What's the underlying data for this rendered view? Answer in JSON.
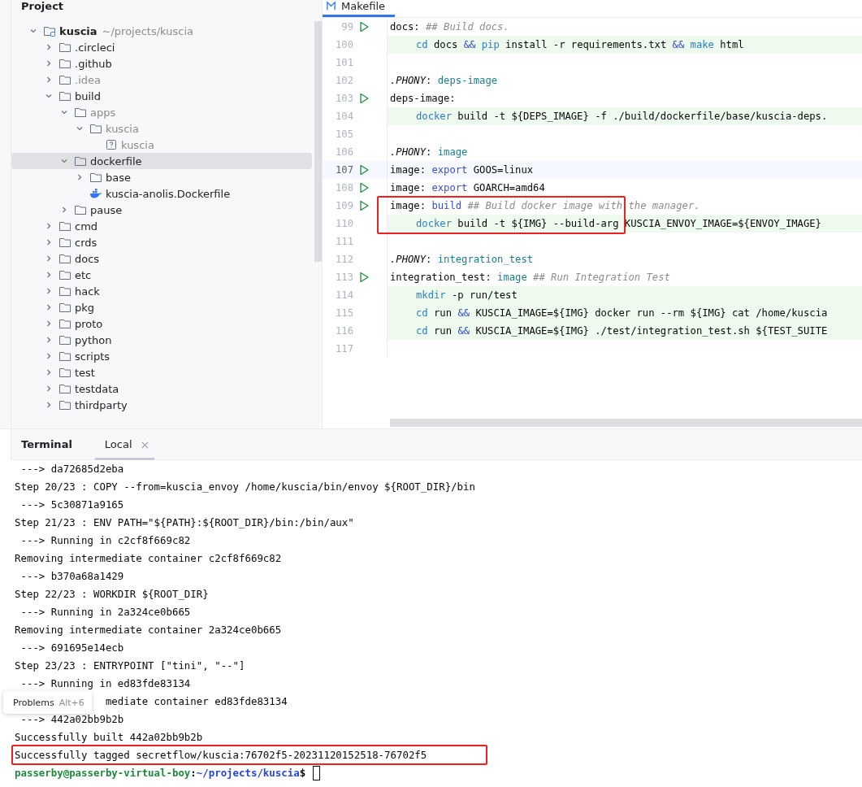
{
  "project_panel": {
    "title": "Project",
    "tree": [
      {
        "name": "kuscia",
        "path": "~/projects/kuscia",
        "kind": "root",
        "expanded": true,
        "excluded": false,
        "selected": false,
        "children": [
          {
            "name": ".circleci",
            "kind": "folder",
            "expanded": false,
            "excluded": false,
            "selected": false
          },
          {
            "name": ".github",
            "kind": "folder",
            "expanded": false,
            "excluded": false,
            "selected": false
          },
          {
            "name": ".idea",
            "kind": "folder",
            "expanded": false,
            "excluded": true,
            "selected": false
          },
          {
            "name": "build",
            "kind": "folder",
            "expanded": true,
            "excluded": false,
            "selected": false,
            "children": [
              {
                "name": "apps",
                "kind": "folder",
                "expanded": true,
                "excluded": true,
                "selected": false,
                "children": [
                  {
                    "name": "kuscia",
                    "kind": "folder",
                    "expanded": true,
                    "excluded": true,
                    "selected": false,
                    "children": [
                      {
                        "name": "kuscia",
                        "kind": "unknown-file",
                        "excluded": true,
                        "selected": false
                      }
                    ]
                  }
                ]
              },
              {
                "name": "dockerfile",
                "kind": "folder",
                "expanded": true,
                "excluded": false,
                "selected": true,
                "children": [
                  {
                    "name": "base",
                    "kind": "folder",
                    "expanded": false,
                    "excluded": false,
                    "selected": false
                  },
                  {
                    "name": "kuscia-anolis.Dockerfile",
                    "kind": "docker-file",
                    "excluded": false,
                    "selected": false
                  }
                ]
              },
              {
                "name": "pause",
                "kind": "folder",
                "expanded": false,
                "excluded": false,
                "selected": false
              }
            ]
          },
          {
            "name": "cmd",
            "kind": "folder",
            "expanded": false,
            "excluded": false,
            "selected": false
          },
          {
            "name": "crds",
            "kind": "folder",
            "expanded": false,
            "excluded": false,
            "selected": false
          },
          {
            "name": "docs",
            "kind": "folder",
            "expanded": false,
            "excluded": false,
            "selected": false
          },
          {
            "name": "etc",
            "kind": "folder",
            "expanded": false,
            "excluded": false,
            "selected": false
          },
          {
            "name": "hack",
            "kind": "folder",
            "expanded": false,
            "excluded": false,
            "selected": false
          },
          {
            "name": "pkg",
            "kind": "folder",
            "expanded": false,
            "excluded": false,
            "selected": false
          },
          {
            "name": "proto",
            "kind": "folder",
            "expanded": false,
            "excluded": false,
            "selected": false
          },
          {
            "name": "python",
            "kind": "folder",
            "expanded": false,
            "excluded": false,
            "selected": false
          },
          {
            "name": "scripts",
            "kind": "folder",
            "expanded": false,
            "excluded": false,
            "selected": false
          },
          {
            "name": "test",
            "kind": "folder",
            "expanded": false,
            "excluded": false,
            "selected": false
          },
          {
            "name": "testdata",
            "kind": "folder",
            "expanded": false,
            "excluded": false,
            "selected": false
          },
          {
            "name": "thirdparty",
            "kind": "folder",
            "expanded": false,
            "excluded": false,
            "selected": false
          }
        ]
      }
    ]
  },
  "editor": {
    "tabs": [
      {
        "label": "Makefile",
        "selected": true
      }
    ],
    "lines": [
      {
        "number": "99",
        "run": true,
        "current": false,
        "recipe": false,
        "segments": [
          {
            "kind": "plain",
            "text": "docs: "
          },
          {
            "kind": "comment",
            "text": "## Build docs."
          }
        ]
      },
      {
        "number": "100",
        "run": false,
        "current": false,
        "recipe": true,
        "segments": [
          {
            "kind": "command",
            "text": "cd"
          },
          {
            "kind": "plain",
            "text": " docs "
          },
          {
            "kind": "op",
            "text": "&&"
          },
          {
            "kind": "command",
            "text": " pip"
          },
          {
            "kind": "plain",
            "text": " install -r requirements.txt "
          },
          {
            "kind": "op",
            "text": "&&"
          },
          {
            "kind": "command",
            "text": " make"
          },
          {
            "kind": "plain",
            "text": " html"
          }
        ]
      },
      {
        "number": "101",
        "run": false,
        "current": false,
        "recipe": false
      },
      {
        "number": "102",
        "run": false,
        "current": false,
        "recipe": false,
        "segments": [
          {
            "kind": "phony",
            "text": ".PHONY"
          },
          {
            "kind": "plain",
            "text": ": "
          },
          {
            "kind": "target",
            "text": "deps-image"
          }
        ]
      },
      {
        "number": "103",
        "run": true,
        "current": false,
        "recipe": false,
        "segments": [
          {
            "kind": "plain",
            "text": "deps-image:"
          }
        ]
      },
      {
        "number": "104",
        "run": false,
        "current": false,
        "recipe": true,
        "segments": [
          {
            "kind": "command",
            "text": "docker"
          },
          {
            "kind": "plain",
            "text": " build -t ${DEPS_IMAGE} -f ./build/dockerfile/base/kuscia-deps."
          }
        ]
      },
      {
        "number": "105",
        "run": false,
        "current": false,
        "recipe": false
      },
      {
        "number": "106",
        "run": false,
        "current": false,
        "recipe": false,
        "segments": [
          {
            "kind": "phony",
            "text": ".PHONY"
          },
          {
            "kind": "plain",
            "text": ": "
          },
          {
            "kind": "target",
            "text": "image"
          }
        ]
      },
      {
        "number": "107",
        "run": true,
        "current": true,
        "recipe": false,
        "segments": [
          {
            "kind": "plain",
            "text": "image: "
          },
          {
            "kind": "keyword",
            "text": "export"
          },
          {
            "kind": "plain",
            "text": " GOOS=linux"
          }
        ]
      },
      {
        "number": "108",
        "run": true,
        "current": false,
        "recipe": false,
        "segments": [
          {
            "kind": "plain",
            "text": "image: "
          },
          {
            "kind": "keyword",
            "text": "export"
          },
          {
            "kind": "plain",
            "text": " GOARCH=amd64"
          }
        ]
      },
      {
        "number": "109",
        "run": true,
        "current": false,
        "recipe": false,
        "segments": [
          {
            "kind": "plain",
            "text": "image: "
          },
          {
            "kind": "keyword",
            "text": "build"
          },
          {
            "kind": "comment",
            "text": " ## Build docker image with the manager."
          }
        ]
      },
      {
        "number": "110",
        "run": false,
        "current": false,
        "recipe": true,
        "segments": [
          {
            "kind": "command",
            "text": "docker"
          },
          {
            "kind": "plain",
            "text": " build -t ${IMG} --build-arg KUSCIA_ENVOY_IMAGE=${ENVOY_IMAGE}"
          }
        ]
      },
      {
        "number": "111",
        "run": false,
        "current": false,
        "recipe": false
      },
      {
        "number": "112",
        "run": false,
        "current": false,
        "recipe": false,
        "segments": [
          {
            "kind": "phony",
            "text": ".PHONY"
          },
          {
            "kind": "plain",
            "text": ": "
          },
          {
            "kind": "target",
            "text": "integration_test"
          }
        ]
      },
      {
        "number": "113",
        "run": true,
        "current": false,
        "recipe": false,
        "segments": [
          {
            "kind": "plain",
            "text": "integration_test: "
          },
          {
            "kind": "target",
            "text": "image"
          },
          {
            "kind": "comment",
            "text": " ## Run Integration Test"
          }
        ]
      },
      {
        "number": "114",
        "run": false,
        "current": false,
        "recipe": true,
        "segments": [
          {
            "kind": "command",
            "text": "mkdir"
          },
          {
            "kind": "plain",
            "text": " -p run/test"
          }
        ]
      },
      {
        "number": "115",
        "run": false,
        "current": false,
        "recipe": true,
        "segments": [
          {
            "kind": "command",
            "text": "cd"
          },
          {
            "kind": "plain",
            "text": " run "
          },
          {
            "kind": "op",
            "text": "&&"
          },
          {
            "kind": "plain",
            "text": " KUSCIA_IMAGE=${IMG} docker run --rm ${IMG} cat /home/kuscia"
          }
        ]
      },
      {
        "number": "116",
        "run": false,
        "current": false,
        "recipe": true,
        "segments": [
          {
            "kind": "command",
            "text": "cd"
          },
          {
            "kind": "plain",
            "text": " run "
          },
          {
            "kind": "op",
            "text": "&&"
          },
          {
            "kind": "plain",
            "text": " KUSCIA_IMAGE=${IMG} ./test/integration_test.sh ${TEST_SUITE"
          }
        ]
      },
      {
        "number": "117",
        "run": false,
        "current": false,
        "recipe": false
      }
    ]
  },
  "terminal": {
    "title": "Terminal",
    "tabs": [
      {
        "label": "Local",
        "selected": true,
        "close": "×"
      }
    ],
    "lines": [
      {
        "kind": "output",
        "text": " ---> da72685d2eba"
      },
      {
        "kind": "output",
        "text": "Step 20/23 : COPY --from=kuscia_envoy /home/kuscia/bin/envoy ${ROOT_DIR}/bin"
      },
      {
        "kind": "output",
        "text": " ---> 5c30871a9165"
      },
      {
        "kind": "output",
        "text": "Step 21/23 : ENV PATH=\"${PATH}:${ROOT_DIR}/bin:/bin/aux\""
      },
      {
        "kind": "output",
        "text": " ---> Running in c2cf8f669c82"
      },
      {
        "kind": "output",
        "text": "Removing intermediate container c2cf8f669c82"
      },
      {
        "kind": "output",
        "text": " ---> b370a68a1429"
      },
      {
        "kind": "output",
        "text": "Step 22/23 : WORKDIR ${ROOT_DIR}"
      },
      {
        "kind": "output",
        "text": " ---> Running in 2a324ce0b665"
      },
      {
        "kind": "output",
        "text": "Removing intermediate container 2a324ce0b665"
      },
      {
        "kind": "output",
        "text": " ---> 691695e14ecb"
      },
      {
        "kind": "output",
        "text": "Step 23/23 : ENTRYPOINT [\"tini\", \"--\"]"
      },
      {
        "kind": "output",
        "text": " ---> Running in ed83fde83134"
      },
      {
        "kind": "covered",
        "text": "mediate container ed83fde83134"
      },
      {
        "kind": "output",
        "text": " ---> 442a02bb9b2b"
      },
      {
        "kind": "output",
        "text": "Successfully built 442a02bb9b2b"
      },
      {
        "kind": "output",
        "text": "Successfully tagged secretflow/kuscia:76702f5-20231120152518-76702f5",
        "annotated": true
      },
      {
        "kind": "prompt",
        "user": "passerby@passerby-virtual-boy",
        "separator": ":",
        "path": "~/projects/kuscia",
        "symbol": "$"
      }
    ]
  },
  "tooltip": {
    "label": "Problems",
    "shortcut": "Alt+6"
  }
}
